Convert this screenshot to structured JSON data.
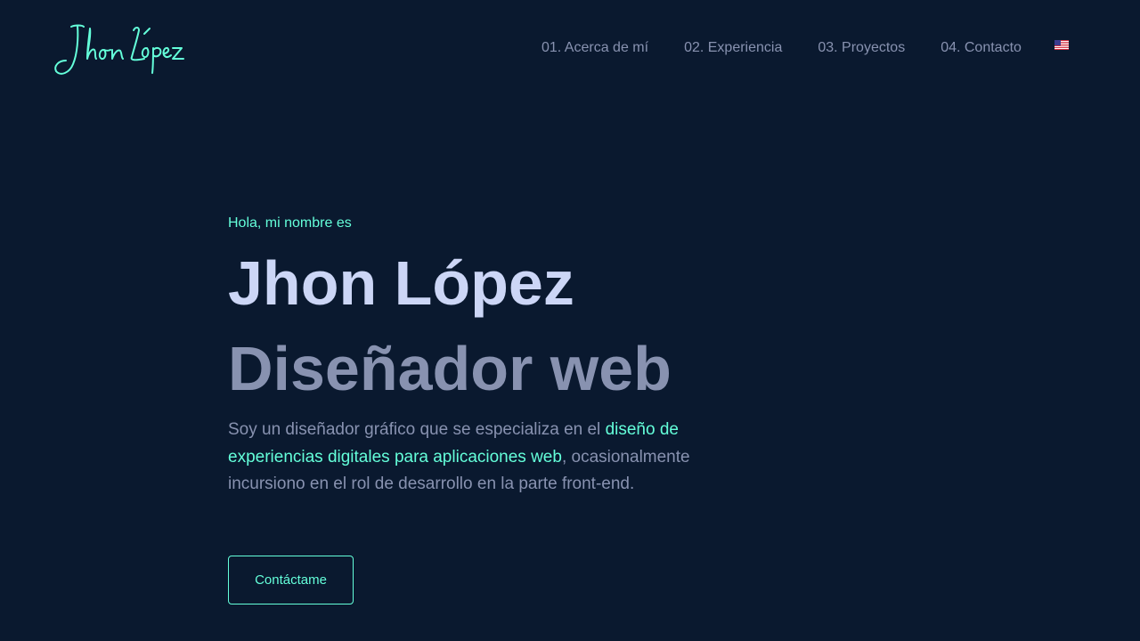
{
  "header": {
    "logo_text": "Jhon López",
    "nav": [
      {
        "label": "01. Acerca de mí"
      },
      {
        "label": "02. Experiencia"
      },
      {
        "label": "03. Proyectos"
      },
      {
        "label": "04. Contacto"
      }
    ],
    "language_icon": "us-flag-icon"
  },
  "hero": {
    "greeting": "Hola, mi nombre es",
    "name": "Jhon López",
    "role": "Diseñador web",
    "intro_part1": "Soy un diseñador gráfico que se especializa en el ",
    "intro_highlight": "diseño de experiencias digitales para aplicaciones web",
    "intro_part2": ", ocasionalmente incursiono en el rol de desarrollo en la parte front-end.",
    "cta_label": "Contáctame"
  },
  "colors": {
    "background": "#0a192f",
    "accent": "#64ffda",
    "heading": "#ccd6f6",
    "text": "#8892b0"
  }
}
